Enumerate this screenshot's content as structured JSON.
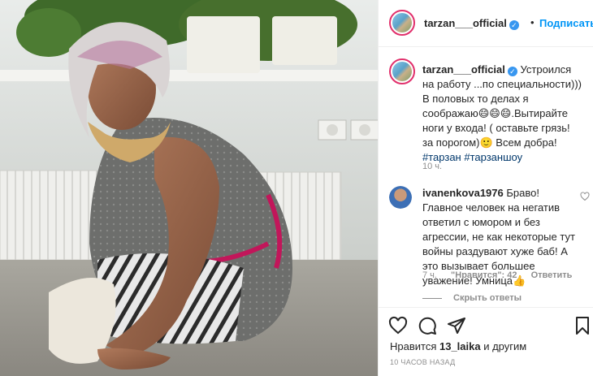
{
  "header": {
    "username": "tarzan___official",
    "separator": "•",
    "follow_label": "Подписаться"
  },
  "caption": {
    "username": "tarzan___official",
    "text": "Устроился на работу ...по специальности))) В половых то делах я соображаю😄😄😄.Вытирайте ноги у входа! ( оставьте грязь! за порогом)🙂 Всем добра!",
    "hashtags": [
      "#тарзан",
      "#тарзаншоу"
    ],
    "time": "10 ч."
  },
  "comment": {
    "username": "ivanenkova1976",
    "text": "Браво! Главное человек на негатив ответил с юмором и без агрессии, не как некоторые тут войны раздувают хуже баб! А это вызывает большее уважение! Умница👍",
    "time": "7 ч.",
    "likes": "\"Нравится\": 42",
    "reply_label": "Ответить",
    "view_replies": "Скрыть ответы"
  },
  "footer": {
    "likes_prefix": "Нравится ",
    "likes_user": "13_laika",
    "likes_suffix": " и другим",
    "time_ago": "10 часов назад"
  },
  "icons": {
    "like": "heart-icon",
    "comment": "comment-icon",
    "share": "share-icon",
    "save": "bookmark-icon"
  },
  "colors": {
    "accent_blue": "#0095f6",
    "hashtag": "#00376b",
    "secondary": "#8e8e8e",
    "story_ring": "#e1306c"
  }
}
